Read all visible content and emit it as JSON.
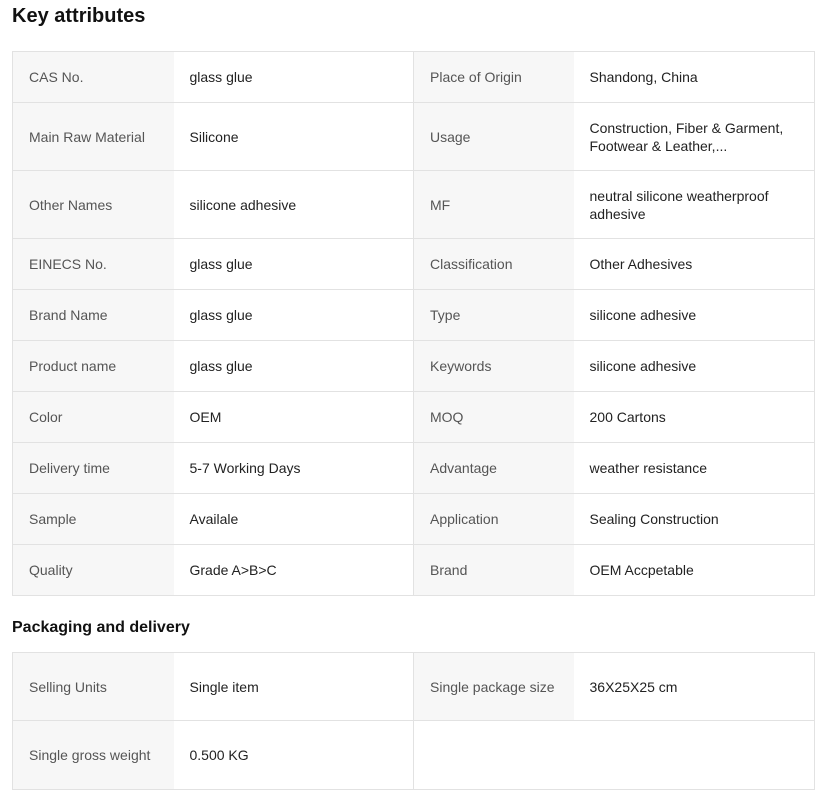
{
  "key_attributes": {
    "title": "Key attributes",
    "rows": [
      [
        {
          "label": "CAS No.",
          "value": "glass glue"
        },
        {
          "label": "Place of Origin",
          "value": "Shandong, China"
        }
      ],
      [
        {
          "label": "Main Raw Material",
          "value": "Silicone"
        },
        {
          "label": "Usage",
          "value": "Construction, Fiber & Garment, Footwear & Leather,..."
        }
      ],
      [
        {
          "label": "Other Names",
          "value": "silicone adhesive"
        },
        {
          "label": "MF",
          "value": "neutral silicone weatherproof adhesive"
        }
      ],
      [
        {
          "label": "EINECS No.",
          "value": "glass glue"
        },
        {
          "label": "Classification",
          "value": "Other Adhesives"
        }
      ],
      [
        {
          "label": "Brand Name",
          "value": "glass glue"
        },
        {
          "label": "Type",
          "value": "silicone adhesive"
        }
      ],
      [
        {
          "label": "Product name",
          "value": "glass glue"
        },
        {
          "label": "Keywords",
          "value": "silicone adhesive"
        }
      ],
      [
        {
          "label": "Color",
          "value": "OEM"
        },
        {
          "label": "MOQ",
          "value": "200 Cartons"
        }
      ],
      [
        {
          "label": "Delivery time",
          "value": "5-7 Working Days"
        },
        {
          "label": "Advantage",
          "value": "weather resistance"
        }
      ],
      [
        {
          "label": "Sample",
          "value": "Availale"
        },
        {
          "label": "Application",
          "value": "Sealing Construction"
        }
      ],
      [
        {
          "label": "Quality",
          "value": "Grade A>B>C"
        },
        {
          "label": "Brand",
          "value": "OEM Accpetable"
        }
      ]
    ]
  },
  "packaging": {
    "title": "Packaging and delivery",
    "rows": [
      [
        {
          "label": "Selling Units",
          "value": "Single item"
        },
        {
          "label": "Single package size",
          "value": "36X25X25 cm"
        }
      ],
      [
        {
          "label": "Single gross weight",
          "value": "0.500 KG"
        }
      ]
    ]
  }
}
